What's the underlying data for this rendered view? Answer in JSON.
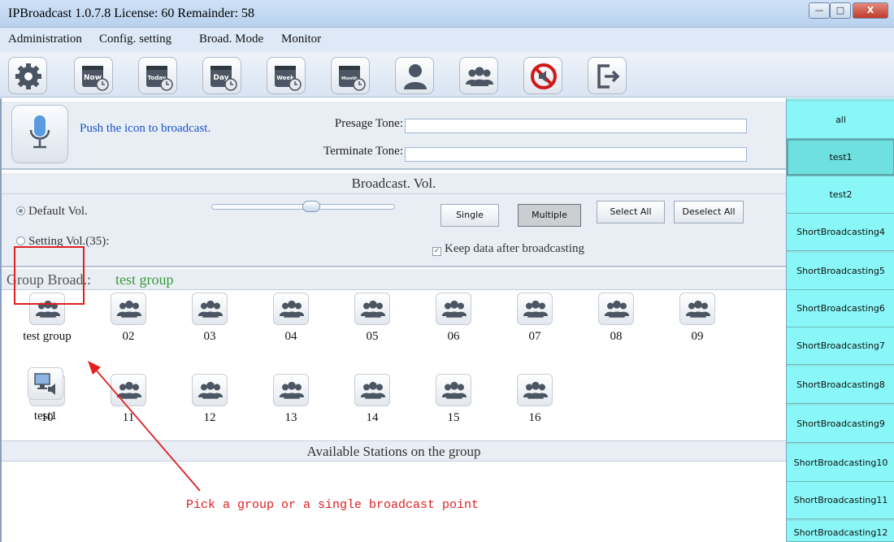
{
  "window": {
    "title": "IPBroadcast 1.0.7.8 License: 60 Remainder: 58",
    "min_glyph": "—",
    "max_glyph": "□",
    "close_glyph": "X"
  },
  "menu": {
    "items": [
      "Administration",
      "Config. setting",
      "Broad. Mode",
      "Monitor"
    ]
  },
  "toolbar": {
    "buttons": [
      {
        "icon": "gear-icon",
        "label": ""
      },
      {
        "icon": "calendar-now-icon",
        "label": "Now"
      },
      {
        "icon": "calendar-today-icon",
        "label": "Today"
      },
      {
        "icon": "calendar-day-icon",
        "label": "Day"
      },
      {
        "icon": "calendar-week-icon",
        "label": "Week"
      },
      {
        "icon": "calendar-month-icon",
        "label": "Month"
      },
      {
        "icon": "user-icon",
        "label": ""
      },
      {
        "icon": "group-icon",
        "label": ""
      },
      {
        "icon": "mute-icon",
        "label": ""
      },
      {
        "icon": "exit-icon",
        "label": ""
      }
    ]
  },
  "broadcast": {
    "push_text": "Push the icon to broadcast.",
    "presage_label": "Presage Tone:",
    "terminate_label": "Terminate Tone:",
    "presage_value": "",
    "terminate_value": ""
  },
  "volume": {
    "header": "Broadcast. Vol.",
    "default_label": "Default Vol.",
    "setting_label": "Setting Vol.(35):",
    "level_percent": 52,
    "single_label": "Single",
    "multiple_label": "Multiple",
    "select_all_label": "Select All",
    "deselect_all_label": "Deselect All",
    "keep_data_label": "Keep data after broadcasting",
    "check_glyph": "✓"
  },
  "groups": {
    "header_label": "Group Broad.:",
    "selected_name": "test group",
    "items": [
      "test group",
      "02",
      "03",
      "04",
      "05",
      "06",
      "07",
      "08",
      "09",
      "10",
      "11",
      "12",
      "13",
      "14",
      "15",
      "16"
    ]
  },
  "stations": {
    "header": "Available Stations on the group",
    "items": [
      "test1"
    ]
  },
  "annotation": {
    "text": "Pick a group or a single broadcast point"
  },
  "sidebar": {
    "items": [
      "all",
      "test1",
      "test2",
      "ShortBroadcasting4",
      "ShortBroadcasting5",
      "ShortBroadcasting6",
      "ShortBroadcasting7",
      "ShortBroadcasting8",
      "ShortBroadcasting9",
      "ShortBroadcasting10",
      "ShortBroadcasting11",
      "ShortBroadcasting12"
    ],
    "active_index": 1
  },
  "colors": {
    "sidebar_bg": "#89f7f7",
    "accent_text": "#1a52c8",
    "group_name": "#3a9a3a",
    "annotation": "#e02020"
  }
}
